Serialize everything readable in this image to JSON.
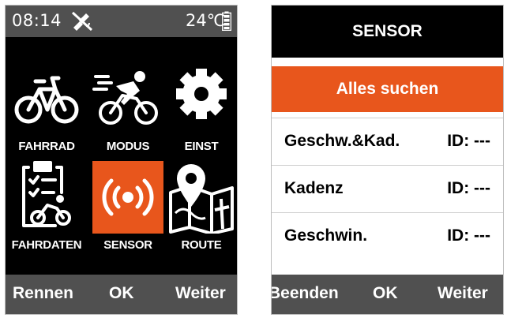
{
  "left_screen": {
    "status": {
      "time": "08:14",
      "temperature": "24℃",
      "gps_icon": "gps-off-icon",
      "battery_icon": "battery-icon"
    },
    "menu": [
      {
        "label": "FAHRRAD",
        "icon": "bicycle-icon",
        "selected": false
      },
      {
        "label": "MODUS",
        "icon": "cyclist-icon",
        "selected": false
      },
      {
        "label": "EINST",
        "icon": "gear-icon",
        "selected": false
      },
      {
        "label": "FAHRDATEN",
        "icon": "ride-data-icon",
        "selected": false
      },
      {
        "label": "SENSOR",
        "icon": "sensor-icon",
        "selected": true
      },
      {
        "label": "ROUTE",
        "icon": "route-map-icon",
        "selected": false
      }
    ],
    "buttons": {
      "left": "Rennen",
      "center": "OK",
      "right": "Weiter"
    }
  },
  "right_screen": {
    "title": "SENSOR",
    "search_all": "Alles suchen",
    "sensors": [
      {
        "name": "Geschw.&Kad.",
        "id": "ID: ---"
      },
      {
        "name": "Kadenz",
        "id": "ID: ---"
      },
      {
        "name": "Geschwin.",
        "id": "ID: ---"
      }
    ],
    "buttons": {
      "left": "Beenden",
      "center": "OK",
      "right": "Weiter"
    }
  },
  "colors": {
    "accent": "#e8561c",
    "bar": "#505050",
    "background": "#000000"
  }
}
